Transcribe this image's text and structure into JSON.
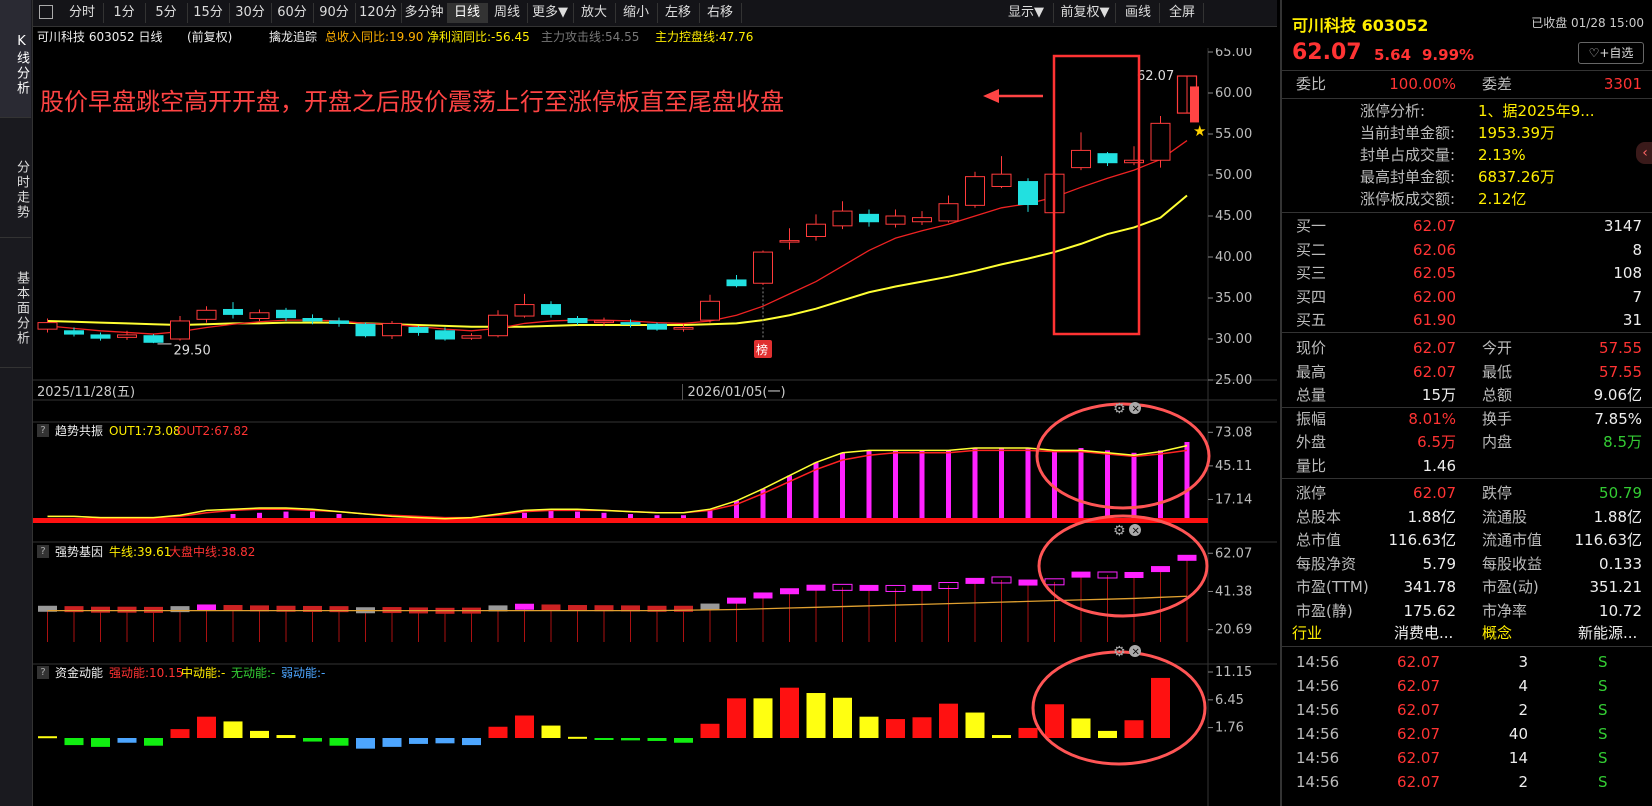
{
  "left_tabs": [
    "K线分析",
    "分时走势",
    "基本面分析"
  ],
  "toolbar": {
    "buttons": [
      "分时",
      "1分",
      "5分",
      "15分",
      "30分",
      "60分",
      "90分",
      "120分",
      "多分钟",
      "日线",
      "周线",
      "更多▼",
      "放大",
      "缩小",
      "左移",
      "右移"
    ],
    "right_buttons": [
      "显示▼",
      "前复权▼",
      "画线",
      "全屏"
    ],
    "active": "日线"
  },
  "infobar": {
    "title": "可川科技 603052 日线",
    "fq": "(前复权)",
    "ind_name": "擒龙追踪",
    "f1": "总收入同比:19.90",
    "f2": "净利润同比:-56.45",
    "f3": "主力攻击线:54.55",
    "f4": "主力控盘线:47.76"
  },
  "annotation": "股价早盘跳空高开开盘，开盘之后股价震荡上行至涨停板直至尾盘收盘",
  "main_chart": {
    "y_ticks": [
      "65.00",
      "60.00",
      "55.00",
      "50.00",
      "45.00",
      "40.00",
      "35.00",
      "30.00",
      "25.00"
    ],
    "low_label": "29.50",
    "high_label": "62.07",
    "dates": [
      "2025/11/28(五)",
      "2026/01/05(一)"
    ],
    "bang": "榜"
  },
  "chart_data": {
    "type": "candlestick",
    "ylim": [
      25,
      65
    ],
    "candles": [
      [
        31.2,
        32.0,
        32.5,
        30.8
      ],
      [
        31.0,
        30.6,
        31.4,
        30.3
      ],
      [
        30.5,
        30.1,
        30.8,
        29.8
      ],
      [
        30.2,
        30.5,
        31.0,
        29.9
      ],
      [
        30.4,
        29.6,
        30.6,
        29.5
      ],
      [
        30.0,
        32.2,
        32.8,
        29.8
      ],
      [
        32.4,
        33.5,
        34.0,
        32.0
      ],
      [
        33.6,
        33.0,
        34.5,
        32.5
      ],
      [
        32.5,
        33.2,
        33.6,
        32.2
      ],
      [
        33.5,
        32.6,
        33.8,
        32.2
      ],
      [
        32.5,
        32.2,
        33.0,
        31.8
      ],
      [
        32.2,
        31.9,
        32.6,
        31.5
      ],
      [
        31.8,
        30.4,
        32.0,
        30.2
      ],
      [
        30.4,
        31.9,
        32.2,
        30.0
      ],
      [
        31.4,
        30.8,
        31.6,
        30.4
      ],
      [
        31.0,
        30.0,
        31.4,
        29.8
      ],
      [
        30.1,
        30.4,
        30.7,
        29.9
      ],
      [
        30.4,
        32.9,
        33.5,
        30.2
      ],
      [
        32.8,
        34.2,
        35.5,
        32.6
      ],
      [
        34.2,
        33.0,
        34.6,
        32.6
      ],
      [
        32.5,
        32.0,
        32.8,
        31.7
      ],
      [
        32.0,
        32.2,
        32.6,
        31.6
      ],
      [
        32.0,
        31.8,
        32.4,
        31.4
      ],
      [
        31.8,
        31.2,
        32.0,
        31.0
      ],
      [
        31.2,
        31.4,
        31.8,
        30.9
      ],
      [
        32.3,
        34.6,
        35.4,
        32.0
      ],
      [
        37.2,
        36.5,
        37.8,
        36.3
      ],
      [
        36.8,
        40.6,
        40.8,
        36.6
      ],
      [
        42.0,
        42.0,
        43.5,
        40.9
      ],
      [
        42.5,
        44.0,
        45.2,
        42.0
      ],
      [
        43.8,
        45.6,
        46.8,
        43.4
      ],
      [
        45.2,
        44.3,
        45.8,
        43.7
      ],
      [
        44.0,
        45.0,
        45.8,
        43.6
      ],
      [
        44.3,
        44.8,
        45.6,
        43.9
      ],
      [
        44.4,
        46.5,
        47.5,
        44.2
      ],
      [
        46.3,
        49.8,
        50.4,
        46.0
      ],
      [
        48.6,
        50.1,
        52.3,
        48.4
      ],
      [
        49.2,
        46.4,
        49.6,
        45.5
      ],
      [
        45.4,
        50.1,
        50.5,
        45.2
      ],
      [
        50.9,
        53.0,
        55.2,
        50.6
      ],
      [
        52.6,
        51.5,
        52.8,
        51.1
      ],
      [
        51.5,
        51.8,
        53.5,
        51.2
      ],
      [
        51.8,
        56.3,
        57.2,
        50.9
      ],
      [
        57.55,
        62.07,
        62.07,
        57.55
      ]
    ],
    "ma1": [
      31.6,
      31.3,
      31.0,
      30.8,
      30.6,
      30.9,
      31.4,
      31.8,
      32.1,
      32.3,
      32.3,
      32.2,
      31.9,
      31.8,
      31.5,
      31.2,
      31.0,
      31.3,
      31.9,
      32.2,
      32.3,
      32.3,
      32.2,
      32.0,
      31.9,
      32.2,
      32.9,
      34.0,
      35.5,
      37.0,
      38.9,
      40.8,
      42.3,
      43.2,
      44.0,
      45.0,
      46.0,
      46.5,
      47.3,
      48.5,
      49.6,
      50.6,
      51.9,
      54.2
    ],
    "ma2": [
      32.2,
      32.1,
      32.0,
      31.9,
      31.8,
      31.7,
      31.8,
      31.9,
      31.9,
      32.0,
      32.0,
      32.0,
      31.9,
      31.8,
      31.7,
      31.6,
      31.5,
      31.5,
      31.5,
      31.6,
      31.7,
      31.7,
      31.7,
      31.7,
      31.7,
      31.8,
      31.9,
      32.3,
      32.9,
      33.7,
      34.7,
      35.7,
      36.4,
      37.0,
      37.6,
      38.3,
      39.1,
      39.8,
      40.6,
      41.6,
      42.8,
      43.6,
      44.8,
      47.5
    ],
    "sub1": {
      "name": "趋势共振",
      "out1": "OUT1:73.08",
      "out2": "OUT2:67.82",
      "ticks": [
        "73.08",
        "45.11",
        "17.14"
      ],
      "bars": [
        0,
        0,
        0,
        0,
        0,
        0,
        0,
        5,
        6,
        7,
        7,
        5,
        0,
        0,
        0,
        0,
        0,
        0,
        6,
        8,
        7,
        6,
        5,
        4,
        4,
        8,
        16,
        26,
        37,
        48,
        56,
        58,
        58,
        58,
        58,
        60,
        60,
        60,
        58,
        60,
        58,
        56,
        58,
        65
      ],
      "line1": [
        3,
        3,
        2,
        2,
        2,
        4,
        8,
        9,
        10,
        10,
        9,
        7,
        5,
        3,
        2,
        1,
        2,
        5,
        8,
        9,
        9,
        8,
        7,
        6,
        6,
        9,
        16,
        26,
        37,
        48,
        56,
        58,
        58,
        58,
        58,
        60,
        60,
        60,
        58,
        58,
        56,
        54,
        57,
        62
      ],
      "line2": [
        3,
        3,
        2,
        2,
        2,
        3,
        6,
        8,
        9,
        9,
        8,
        7,
        5,
        4,
        3,
        2,
        2,
        4,
        7,
        8,
        8,
        8,
        7,
        6,
        6,
        8,
        13,
        22,
        32,
        42,
        50,
        54,
        56,
        56,
        56,
        58,
        58,
        58,
        57,
        57,
        55,
        53,
        55,
        58
      ]
    },
    "sub2": {
      "name": "强势基因",
      "l1": "牛线:39.61",
      "l2": "大盘中线:38.82",
      "ticks": [
        "62.07",
        "41.38",
        "20.69"
      ],
      "vals": [
        32,
        31.8,
        31.5,
        31.5,
        31.4,
        31.8,
        32.7,
        32.4,
        32.2,
        32.0,
        31.9,
        31.8,
        31.2,
        31.3,
        31.1,
        30.9,
        31.0,
        32.2,
        33.1,
        32.7,
        32.4,
        32.3,
        32.2,
        32.0,
        32.0,
        33.2,
        36.4,
        39.2,
        41.5,
        43.4,
        43.6,
        43.3,
        43.0,
        43.3,
        44.6,
        47.1,
        47.6,
        46.2,
        46.6,
        50.5,
        50.3,
        50.3,
        53.5,
        59.6
      ],
      "colors": [
        "g",
        "r",
        "r",
        "r",
        "r",
        "g",
        "m",
        "r",
        "r",
        "r",
        "r",
        "r",
        "g",
        "r",
        "r",
        "r",
        "r",
        "g",
        "m",
        "r",
        "r",
        "r",
        "r",
        "r",
        "r",
        "g",
        "m",
        "m",
        "m",
        "m",
        "m",
        "m",
        "m",
        "m",
        "m",
        "m",
        "m",
        "m",
        "m",
        "m",
        "m",
        "m",
        "m",
        "m"
      ],
      "line": [
        31,
        31,
        31,
        31,
        31,
        31,
        31,
        31,
        31,
        31,
        31,
        31,
        31,
        31,
        31,
        31,
        31,
        31,
        31,
        31,
        31,
        31,
        31,
        31,
        31.2,
        31.4,
        31.6,
        32,
        32.4,
        32.8,
        33.2,
        33.6,
        34,
        34.4,
        34.8,
        35.2,
        35.6,
        36,
        36.4,
        36.8,
        37.2,
        37.6,
        38.2,
        38.8
      ]
    },
    "sub3": {
      "name": "资金动能",
      "s1": "强动能:10.15",
      "s2": "中动能:-",
      "s3": "无动能:-",
      "s4": "弱动能:-",
      "ticks": [
        "11.15",
        "6.45",
        "1.76"
      ],
      "vals": [
        0.3,
        -1.2,
        -1.5,
        -0.8,
        -1.3,
        1.5,
        3.6,
        2.8,
        1.2,
        0.5,
        -0.6,
        -1.3,
        -1.8,
        -1.5,
        -1.0,
        -0.9,
        -1.2,
        1.9,
        3.8,
        2.1,
        0.2,
        -0.3,
        -0.4,
        -0.5,
        -0.8,
        2.4,
        6.7,
        6.7,
        8.5,
        7.6,
        6.8,
        3.6,
        3.2,
        3.5,
        5.8,
        4.3,
        0.5,
        1.7,
        5.7,
        3.3,
        1.2,
        3.0,
        10.15
      ],
      "colors": [
        "y",
        "g",
        "g",
        "b",
        "g",
        "r",
        "r",
        "y",
        "y",
        "y",
        "g",
        "g",
        "b",
        "b",
        "b",
        "b",
        "b",
        "r",
        "r",
        "y",
        "y",
        "g",
        "g",
        "g",
        "g",
        "r",
        "r",
        "y",
        "r",
        "y",
        "y",
        "y",
        "r",
        "r",
        "r",
        "y",
        "y",
        "r",
        "r",
        "y",
        "y",
        "r",
        "r"
      ]
    }
  },
  "right": {
    "stock": "可川科技 603052",
    "status": "已收盘 01/28 15:00",
    "price": "62.07",
    "chg": "5.64",
    "pct": "9.99%",
    "watch_btn": "+自选",
    "wb_lbl": "委比",
    "wb": "100.00%",
    "wc_lbl": "委差",
    "wc": "3301",
    "zt_rows": [
      [
        "涨停分析:",
        "1、据2025年9..."
      ],
      [
        "当前封单金额:",
        "1953.39万"
      ],
      [
        "封单占成交量:",
        "2.13%"
      ],
      [
        "最高封单金额:",
        "6837.26万"
      ],
      [
        "涨停板成交额:",
        "2.12亿"
      ]
    ],
    "buy": [
      [
        "买一",
        "62.07",
        "3147"
      ],
      [
        "买二",
        "62.06",
        "8"
      ],
      [
        "买三",
        "62.05",
        "108"
      ],
      [
        "买四",
        "62.00",
        "7"
      ],
      [
        "买五",
        "61.90",
        "31"
      ]
    ],
    "stats": [
      [
        "现价",
        "62.07",
        "今开",
        "57.55"
      ],
      [
        "最高",
        "62.07",
        "最低",
        "57.55"
      ],
      [
        "总量",
        "15万",
        "总额",
        "9.06亿"
      ],
      [
        "振幅",
        "8.01%",
        "换手",
        "7.85%"
      ],
      [
        "外盘",
        "6.5万",
        "内盘",
        "8.5万"
      ],
      [
        "量比",
        "1.46",
        "",
        ""
      ],
      [
        "涨停",
        "62.07",
        "跌停",
        "50.79"
      ],
      [
        "总股本",
        "1.88亿",
        "流通股",
        "1.88亿"
      ],
      [
        "总市值",
        "116.63亿",
        "流通市值",
        "116.63亿"
      ],
      [
        "每股净资",
        "5.79",
        "每股收益",
        "0.133"
      ],
      [
        "市盈(TTM)",
        "341.78",
        "市盈(动)",
        "351.21"
      ],
      [
        "市盈(静)",
        "175.62",
        "市净率",
        "10.72"
      ]
    ],
    "industry": [
      "行业",
      "消费电...",
      "概念",
      "新能源..."
    ],
    "ticks": [
      [
        "14:56",
        "62.07",
        "3",
        "S"
      ],
      [
        "14:56",
        "62.07",
        "4",
        "S"
      ],
      [
        "14:56",
        "62.07",
        "2",
        "S"
      ],
      [
        "14:56",
        "62.07",
        "40",
        "S"
      ],
      [
        "14:56",
        "62.07",
        "14",
        "S"
      ],
      [
        "14:56",
        "62.07",
        "2",
        "S"
      ]
    ],
    "colors": {
      "up": "#ff3333",
      "down": "#33cc33",
      "flat": "#eeeeee",
      "accent": "#ffee00"
    }
  }
}
